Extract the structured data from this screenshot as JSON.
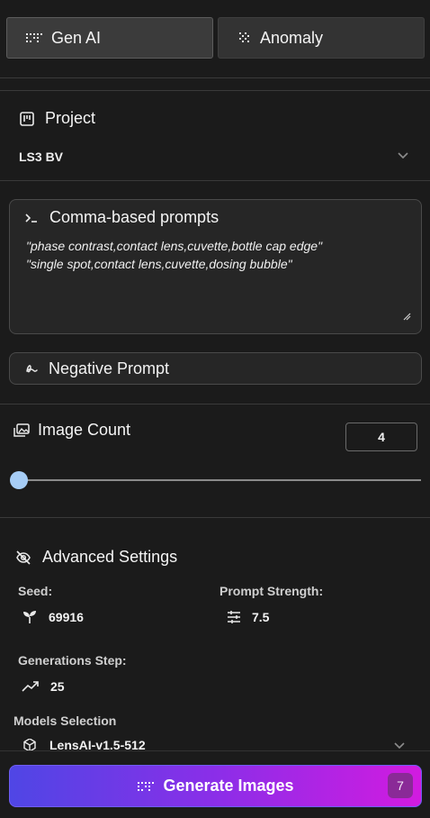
{
  "tabs": [
    {
      "label": "Gen AI",
      "icon": "grid-dots-icon",
      "active": true
    },
    {
      "label": "Anomaly",
      "icon": "checker-dots-icon",
      "active": false
    }
  ],
  "project": {
    "title": "Project",
    "icon": "project-board-icon",
    "selected": "LS3 BV"
  },
  "prompts": {
    "title": "Comma-based prompts",
    "icon": "terminal-prompt-icon",
    "lines": [
      "\"phase contrast,contact lens,cuvette,bottle cap edge\"",
      "\"single spot,contact lens,cuvette,dosing bubble\""
    ]
  },
  "negative_prompt": {
    "label": "Negative Prompt",
    "icon": "squiggle-icon"
  },
  "image_count": {
    "title": "Image Count",
    "icon": "images-icon",
    "value": "4"
  },
  "advanced": {
    "title": "Advanced Settings",
    "icon": "eye-off-icon",
    "seed_label": "Seed:",
    "seed_value": "69916",
    "prompt_strength_label": "Prompt Strength:",
    "prompt_strength_value": "7.5",
    "generation_steps_label": "Generations Step:",
    "generation_steps_value": "25",
    "models_label": "Models Selection",
    "model_value": "LensAI-v1.5-512"
  },
  "generate": {
    "label": "Generate Images",
    "count": "7"
  },
  "colors": {
    "background": "#1b1b1b",
    "slider_thumb": "#a6cdf6",
    "gradient_start": "#4f46e5",
    "gradient_end": "#d21be0"
  }
}
